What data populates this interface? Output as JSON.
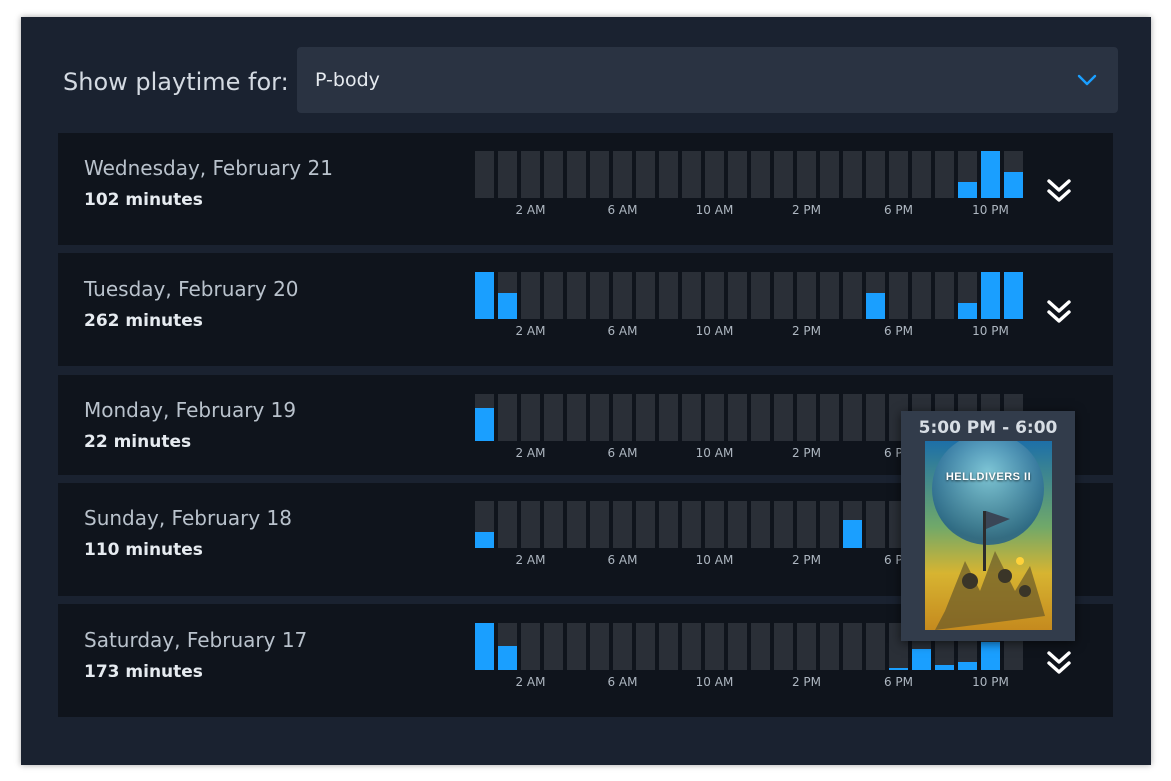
{
  "filter": {
    "label": "Show playtime for:",
    "selected": "P-body",
    "chevron_icon": "chevron-down-icon"
  },
  "colors": {
    "accent": "#1a9fff",
    "empty_bar": "#2a2f37",
    "row_bg": "#0f141c",
    "panel_bg": "#1a2230"
  },
  "days": [
    {
      "date": "Wednesday, February 21",
      "total": "102 minutes",
      "hours": [
        0,
        0,
        0,
        0,
        0,
        0,
        0,
        0,
        0,
        0,
        0,
        0,
        0,
        0,
        0,
        0,
        0,
        0,
        0,
        0,
        0,
        0.33,
        1.0,
        0.55
      ]
    },
    {
      "date": "Tuesday, February 20",
      "total": "262 minutes",
      "hours": [
        1.0,
        0.55,
        0,
        0,
        0,
        0,
        0,
        0,
        0,
        0,
        0,
        0,
        0,
        0,
        0,
        0,
        0,
        0.55,
        0,
        0,
        0,
        0.33,
        1.0,
        1.0
      ]
    },
    {
      "date": "Monday, February 19",
      "total": "22 minutes",
      "hours": [
        0.7,
        0,
        0,
        0,
        0,
        0,
        0,
        0,
        0,
        0,
        0,
        0,
        0,
        0,
        0,
        0,
        0,
        0,
        0,
        0,
        0,
        0,
        0,
        0
      ]
    },
    {
      "date": "Sunday, February 18",
      "total": "110 minutes",
      "hours": [
        0.35,
        0,
        0,
        0,
        0,
        0,
        0,
        0,
        0,
        0,
        0,
        0,
        0,
        0,
        0,
        0,
        0.6,
        0,
        0,
        0,
        0,
        0,
        0,
        0
      ]
    },
    {
      "date": "Saturday, February 17",
      "total": "173 minutes",
      "hours": [
        1.0,
        0.5,
        0,
        0,
        0,
        0,
        0,
        0,
        0,
        0,
        0,
        0,
        0,
        0,
        0,
        0,
        0,
        0,
        0.05,
        0.45,
        0.1,
        0.17,
        0.6,
        0
      ]
    }
  ],
  "axis_labels": [
    "2 AM",
    "6 AM",
    "10 AM",
    "2 PM",
    "6 PM",
    "10 PM"
  ],
  "expand_icon": "double-chevron-down-icon",
  "tooltip": {
    "time_range": "5:00 PM - 6:00 PM",
    "game_logo_text": "HELLDIVERS II"
  }
}
